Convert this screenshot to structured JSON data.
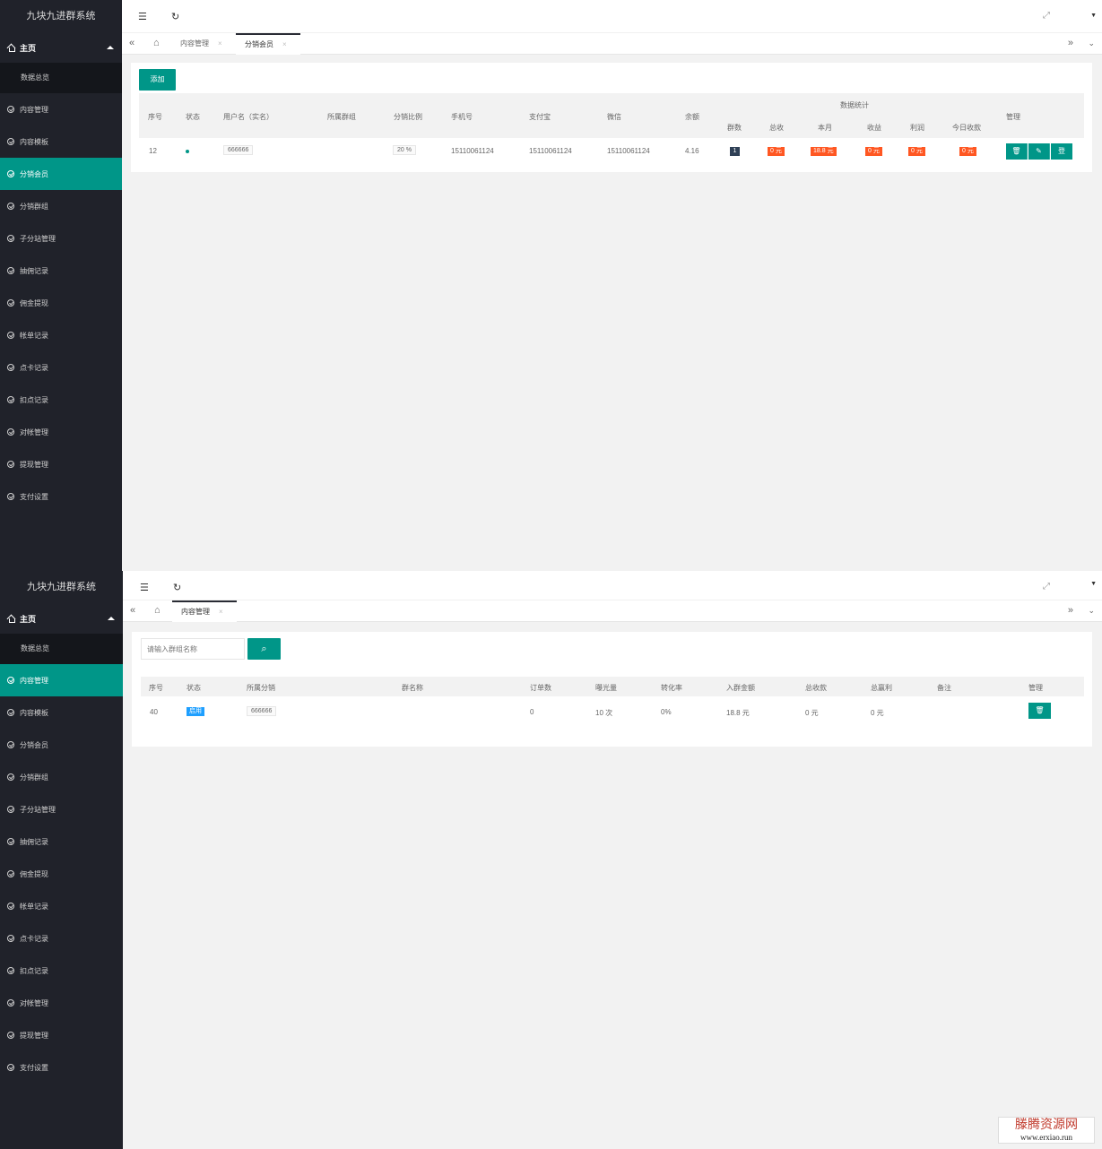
{
  "app": {
    "title": "九块九进群系统"
  },
  "sidebar": {
    "home": "主页",
    "overview": "数据总览",
    "items": [
      "内容管理",
      "内容模板",
      "分销会员",
      "分销群组",
      "子分站管理",
      "抽佣记录",
      "佣金提现",
      "帐单记录",
      "点卡记录",
      "扣点记录",
      "对帐管理",
      "提现管理",
      "支付设置"
    ]
  },
  "header": {
    "menu_icon": "menu-fold-icon",
    "refresh_icon": "refresh-icon",
    "fullscreen_icon": "fullscreen-icon"
  },
  "top": {
    "tabs": [
      {
        "label": "内容管理"
      },
      {
        "label": "分销会员"
      }
    ],
    "add_label": "添加",
    "group_header": "数据统计",
    "columns": [
      "序号",
      "状态",
      "用户名（实名）",
      "所属群组",
      "分销比例",
      "手机号",
      "支付宝",
      "微信",
      "余额",
      "管理"
    ],
    "stat_columns": [
      "群数",
      "总收",
      "本月",
      "收益",
      "利润",
      "今日收款"
    ],
    "row": {
      "id": "12",
      "username": "666666",
      "ratio": "20 %",
      "phone": "15110061124",
      "alipay": "15110061124",
      "wechat": "15110061124",
      "balance": "4.16",
      "groups": "1",
      "total": "0 元",
      "month": "18.8 元",
      "income": "0 元",
      "profit": "0 元",
      "today": "0 元",
      "login_label": "登"
    }
  },
  "bottom": {
    "tabs": [
      {
        "label": "内容管理"
      }
    ],
    "search": {
      "placeholder": "请输入群组名称"
    },
    "columns": [
      "序号",
      "状态",
      "所属分销",
      "群名称",
      "订单数",
      "曝光量",
      "转化率",
      "入群金额",
      "总收款",
      "总赢利",
      "备注",
      "管理"
    ],
    "row": {
      "id": "40",
      "status": "启用",
      "distributor": "666666",
      "orders": "0",
      "views": "10 次",
      "rate": "0%",
      "price": "18.8 元",
      "collected": "0 元",
      "profit": "0 元"
    }
  },
  "watermark": {
    "title": "滕腾资源网",
    "url": "www.erxiao.run"
  },
  "colors": {
    "accent": "#009688",
    "sidebar": "#20222a",
    "orange": "#ff5722",
    "blue": "#1e9fff"
  }
}
